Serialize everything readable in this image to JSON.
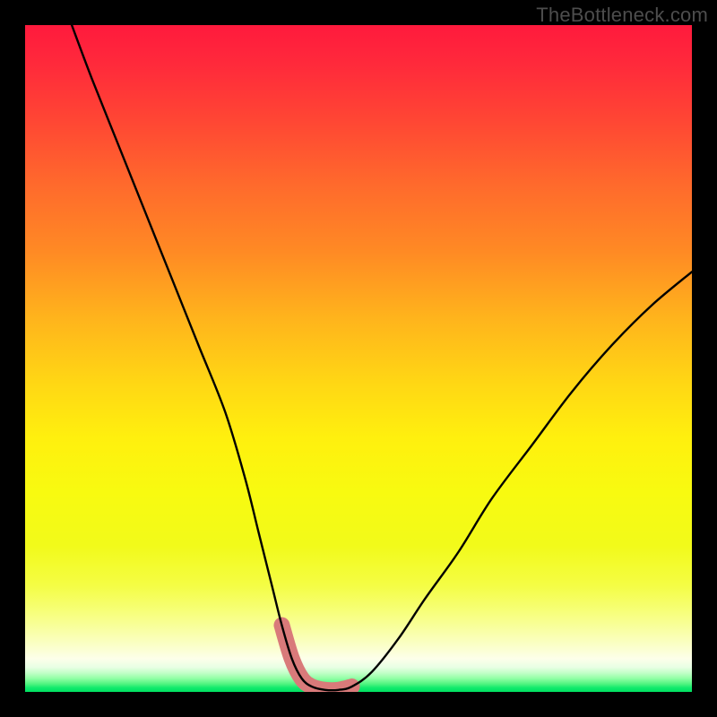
{
  "watermark": {
    "text": "TheBottleneck.com"
  },
  "colors": {
    "frame": "#000000",
    "curve": "#000000",
    "highlight": "#d97a7a",
    "gradient_top": "#ff1a3d",
    "gradient_mid": "#fff00e",
    "gradient_bottom": "#00e060"
  },
  "chart_data": {
    "type": "line",
    "title": "",
    "xlabel": "",
    "ylabel": "",
    "xlim": [
      0,
      100
    ],
    "ylim": [
      0,
      100
    ],
    "grid": false,
    "legend_position": "none",
    "series": [
      {
        "name": "bottleneck-curve",
        "x": [
          7,
          10,
          14,
          18,
          22,
          26,
          30,
          33,
          35,
          37,
          38.5,
          40,
          41.5,
          43,
          45,
          47,
          49,
          52,
          56,
          60,
          65,
          70,
          76,
          82,
          88,
          94,
          100
        ],
        "y": [
          100,
          92,
          82,
          72,
          62,
          52,
          42,
          32,
          24,
          16,
          10,
          5,
          2,
          0.8,
          0.3,
          0.3,
          0.8,
          3,
          8,
          14,
          21,
          29,
          37,
          45,
          52,
          58,
          63
        ]
      }
    ],
    "highlight_segment": {
      "name": "minimum-region",
      "x": [
        38.5,
        40,
        41.5,
        43,
        45,
        47,
        49
      ],
      "y": [
        10,
        5,
        2,
        0.8,
        0.3,
        0.3,
        0.8
      ]
    }
  }
}
